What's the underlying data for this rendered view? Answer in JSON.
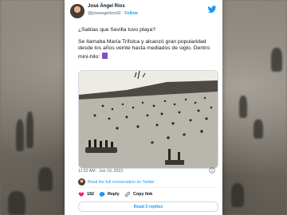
{
  "tweet": {
    "author_name": "José Ángel Ríos",
    "author_handle": "@joseangelrios92",
    "follow_label": "Follow",
    "paragraph1": "¿Sabías que Sevilla tuvo playa?",
    "paragraph2": "Se llamaba María Trifulca y alcanzó gran popularidad desde los años veinte hasta mediados de siglo. Dentro mini-hilo:",
    "timestamp": "11:52 AM · Jun 19, 2023",
    "read_conversation_label": "Read the full conversation on Twitter",
    "likes": "182",
    "reply_label": "Reply",
    "copy_link_label": "Copy link",
    "read_replies_label": "Read 2 replies"
  },
  "icons": {
    "brand": "twitter-bird-icon",
    "thread": "thread-emoji-icon",
    "info": "info-icon",
    "like": "heart-icon",
    "reply": "reply-bubble-icon",
    "copy": "link-icon"
  },
  "colors": {
    "accent": "#1d9bf0",
    "like": "#f91880",
    "text": "#0f1419",
    "muted": "#536471"
  }
}
